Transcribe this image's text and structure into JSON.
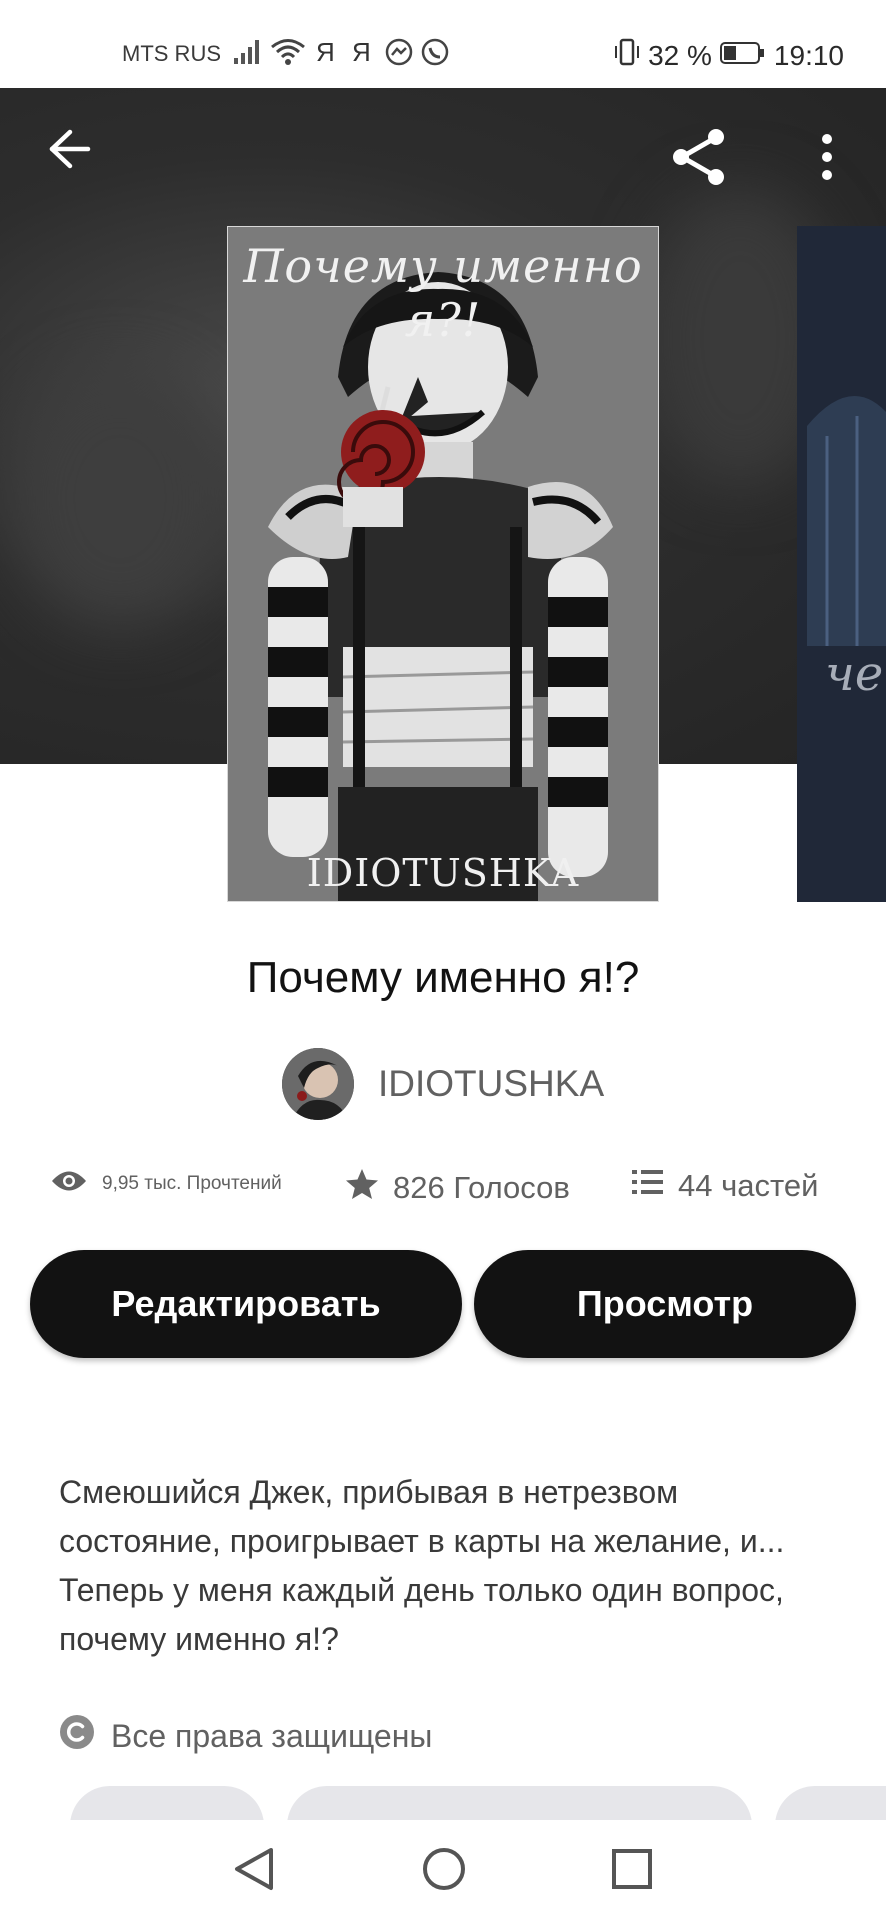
{
  "status_bar": {
    "carrier": "MTS RUS",
    "app_glyph_1": "Я",
    "app_glyph_2": "Я",
    "battery": "32 %",
    "time": "19:10",
    "icons": [
      "signal-icon",
      "wifi-icon",
      "messenger-icon",
      "whatsapp-icon",
      "vibrate-icon",
      "battery-icon"
    ]
  },
  "toolbar": {
    "icons": [
      "back-arrow-icon",
      "share-icon",
      "more-vert-icon"
    ]
  },
  "cover": {
    "title_text": "Почему именно я?!",
    "signature": "IDIOTUSHKA"
  },
  "cover_next": {
    "text": "че"
  },
  "story": {
    "title": "Почему именно я!?",
    "author": "IDIOTUSHKA",
    "reads": "9,95 тыс. Прочтений",
    "votes": "826 Голосов",
    "parts": "44 частей",
    "description": "Смеюшийся Джек, прибывая в нетрезвом состояние, проигрывает в карты на желание, и... Теперь у меня каждый день только один вопрос, почему именно я!?",
    "copyright": "Все права защищены"
  },
  "actions": {
    "edit_label": "Редактировать",
    "view_label": "Просмотр"
  },
  "colors": {
    "accent": "#121212",
    "hero_bg": "#2d2d2d",
    "muted_text": "#616161",
    "tag_bg": "#e6e6ea"
  },
  "nav_bar": {
    "icons": [
      "nav-back-icon",
      "nav-home-icon",
      "nav-recents-icon"
    ]
  }
}
